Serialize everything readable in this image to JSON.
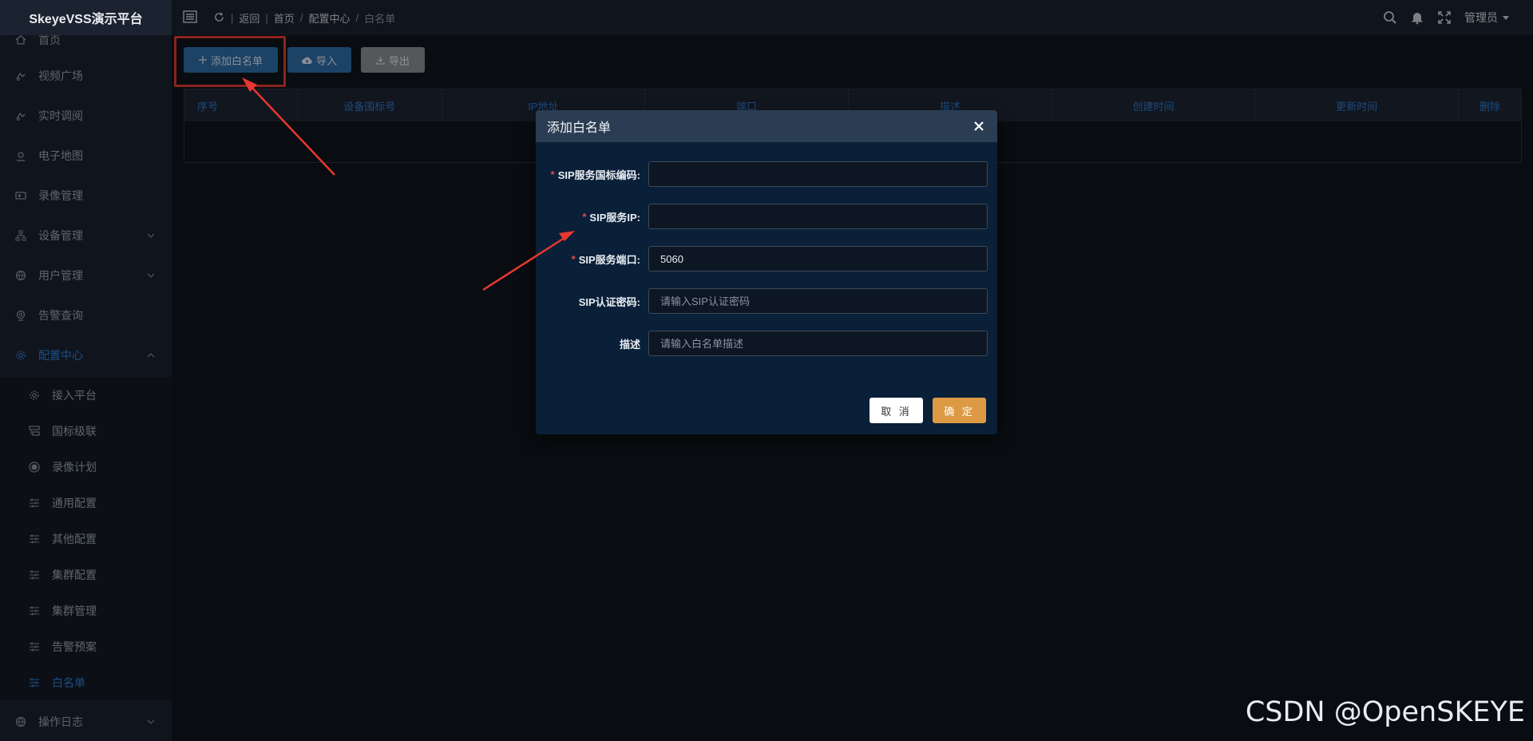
{
  "app": {
    "title": "SkeyeVSS演示平台"
  },
  "sidebar": {
    "items": [
      {
        "label": "首页",
        "icon": "home-icon"
      },
      {
        "label": "视频广场",
        "icon": "video-square-icon"
      },
      {
        "label": "实时调阅",
        "icon": "live-view-icon"
      },
      {
        "label": "电子地图",
        "icon": "map-pin-icon"
      },
      {
        "label": "录像管理",
        "icon": "recording-icon"
      },
      {
        "label": "设备管理",
        "icon": "device-tree-icon"
      },
      {
        "label": "用户管理",
        "icon": "globe-icon"
      },
      {
        "label": "告警查询",
        "icon": "camera-alarm-icon"
      },
      {
        "label": "配置中心",
        "icon": "gear-icon"
      }
    ],
    "sub_items": [
      {
        "label": "接入平台",
        "icon": "gear-icon"
      },
      {
        "label": "国标级联",
        "icon": "cascade-icon"
      },
      {
        "label": "录像计划",
        "icon": "record-plan-icon"
      },
      {
        "label": "通用配置",
        "icon": "sliders-icon"
      },
      {
        "label": "其他配置",
        "icon": "sliders-icon"
      },
      {
        "label": "集群配置",
        "icon": "sliders-icon"
      },
      {
        "label": "集群管理",
        "icon": "sliders-icon"
      },
      {
        "label": "告警预案",
        "icon": "sliders-icon"
      },
      {
        "label": "白名单",
        "icon": "sliders-icon"
      }
    ],
    "bottom_item": {
      "label": "操作日志",
      "icon": "globe-icon"
    }
  },
  "header": {
    "breadcrumb": [
      "返回",
      "首页",
      "配置中心",
      "白名单"
    ],
    "user": "管理员"
  },
  "toolbar": {
    "add_label": "添加白名单",
    "import_label": "导入",
    "export_label": "导出"
  },
  "table": {
    "columns": [
      "序号",
      "设备国标号",
      "IP地址",
      "端口",
      "描述",
      "创建时间",
      "更新时间",
      "删除"
    ]
  },
  "dialog": {
    "title": "添加白名单",
    "fields": [
      {
        "label": "SIP服务国标编码:",
        "required": true,
        "value": "",
        "placeholder": ""
      },
      {
        "label": "SIP服务IP:",
        "required": true,
        "value": "",
        "placeholder": ""
      },
      {
        "label": "SIP服务端口:",
        "required": true,
        "value": "5060",
        "placeholder": ""
      },
      {
        "label": "SIP认证密码:",
        "required": false,
        "value": "",
        "placeholder": "请输入SIP认证密码"
      },
      {
        "label": "描述",
        "required": false,
        "value": "",
        "placeholder": "请输入白名单描述"
      }
    ],
    "cancel_label": "取 消",
    "ok_label": "确 定"
  },
  "colors": {
    "accent": "#2f7ed8",
    "primary_button": "#2e6ba5",
    "confirm_button": "#dd9a44",
    "annotation_red": "#e03a33"
  },
  "watermark": "CSDN @OpenSKEYE"
}
